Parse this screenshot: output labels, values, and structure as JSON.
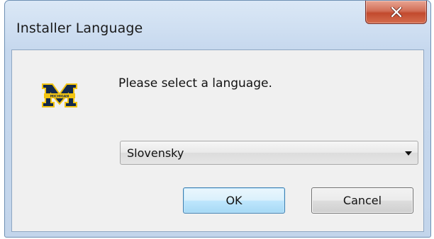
{
  "window": {
    "title": "Installer Language",
    "close_icon": "close-x-icon"
  },
  "dialog": {
    "logo": "michigan-m-logo",
    "logo_text": "MICHIGAN",
    "prompt": "Please select a language.",
    "language_select": {
      "selected": "Slovensky"
    },
    "ok_label": "OK",
    "cancel_label": "Cancel"
  },
  "colors": {
    "logo_navy": "#13294b",
    "logo_maize": "#f2c413",
    "close_button_red": "#c24a2e",
    "ok_button_blue": "#a7d9f5"
  }
}
